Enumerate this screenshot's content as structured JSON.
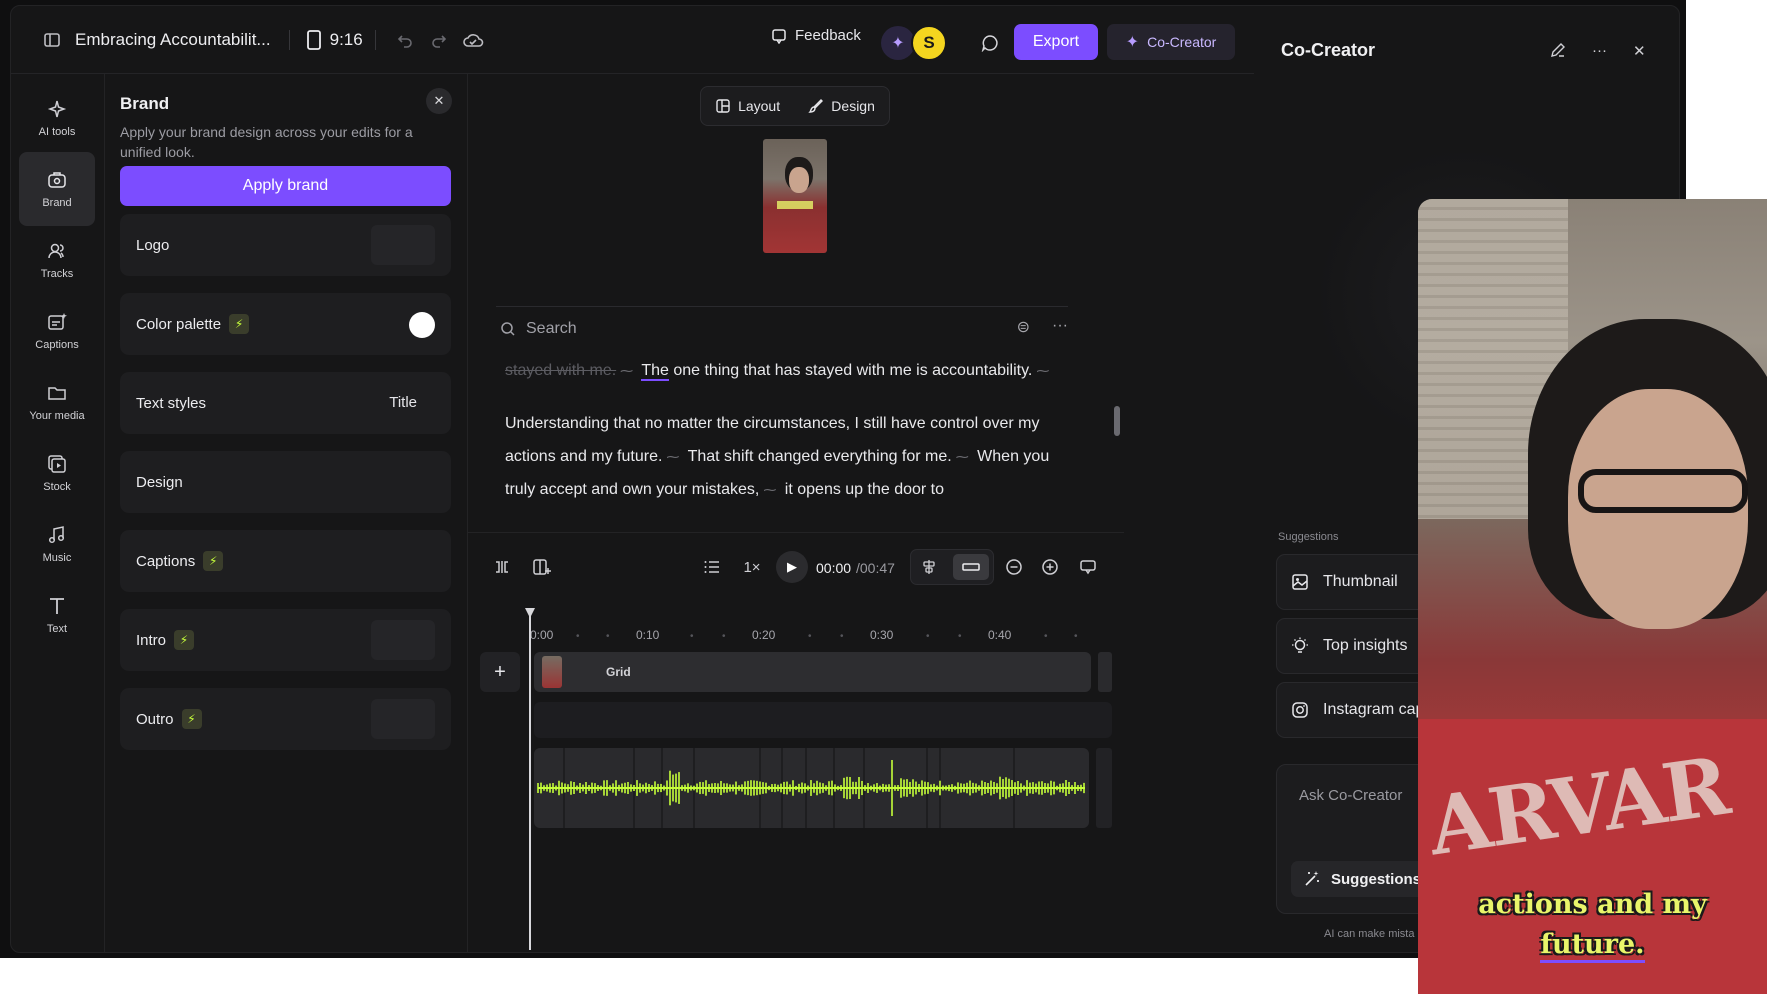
{
  "topbar": {
    "project_title": "Embracing Accountabilit...",
    "aspect_ratio": "9:16",
    "feedback_label": "Feedback",
    "avatar_initial": "S",
    "export_label": "Export",
    "cocreator_label": "Co-Creator",
    "icons": [
      "sidebar-toggle-icon",
      "phone-frame-icon",
      "undo-icon",
      "redo-icon",
      "cloud-save-icon",
      "feedback-icon",
      "sparkle-icon",
      "chat-icon"
    ]
  },
  "rail": {
    "items": [
      {
        "label": "AI tools",
        "icon": "sparkles-icon"
      },
      {
        "label": "Brand",
        "icon": "brand-kit-icon",
        "active": true
      },
      {
        "label": "Tracks",
        "icon": "users-icon"
      },
      {
        "label": "Captions",
        "icon": "captions-icon"
      },
      {
        "label": "Your media",
        "icon": "folder-icon"
      },
      {
        "label": "Stock",
        "icon": "stock-media-icon"
      },
      {
        "label": "Music",
        "icon": "music-note-icon"
      },
      {
        "label": "Text",
        "icon": "text-icon"
      }
    ]
  },
  "brand": {
    "title": "Brand",
    "description": "Apply your brand design across your edits for a unified look.",
    "apply_label": "Apply brand",
    "cards": [
      {
        "label": "Logo",
        "bolt": false,
        "trailing": "box"
      },
      {
        "label": "Color palette",
        "bolt": true,
        "trailing": "white-dot"
      },
      {
        "label": "Text styles",
        "bolt": false,
        "trailing": "text",
        "value": "Title"
      },
      {
        "label": "Design",
        "bolt": false,
        "trailing": "none"
      },
      {
        "label": "Captions",
        "bolt": true,
        "trailing": "none"
      },
      {
        "label": "Intro",
        "bolt": true,
        "trailing": "box"
      },
      {
        "label": "Outro",
        "bolt": true,
        "trailing": "box"
      }
    ]
  },
  "center": {
    "layout_label": "Layout",
    "design_label": "Design",
    "search_placeholder": "Search",
    "transcript": {
      "struck": "stayed with me.",
      "p1_a": "The",
      "p1_b": "one thing that has stayed with me is accountability.",
      "p2_a": "Understanding that no matter the circumstances, I still have control over my actions and my future.",
      "p2_b": "That shift changed everything for me.",
      "p2_c": "When you truly accept and own your mistakes,",
      "p2_d": "it opens up the door to"
    },
    "player": {
      "speed": "1×",
      "current_time": "00:00",
      "total_time": "/00:47"
    },
    "timeline": {
      "ruler": [
        "0:00",
        "0:10",
        "0:20",
        "0:30",
        "0:40"
      ],
      "track_label": "Grid"
    }
  },
  "right_panel": {
    "title": "Co-Creator",
    "suggestions_label": "Suggestions",
    "suggestions": [
      {
        "label": "Thumbnail",
        "icon": "image-icon"
      },
      {
        "label": "Top insights",
        "icon": "lightbulb-icon"
      },
      {
        "label": "Instagram cap",
        "icon": "instagram-icon"
      }
    ],
    "ask_placeholder": "Ask Co-Creator",
    "ask_suggestions_label": "Suggestions",
    "disclaimer": "AI can make mista"
  },
  "overlay": {
    "caption_line1": "actions and my",
    "caption_line2": "future.",
    "shirt_text": "ARVAR"
  },
  "colors": {
    "accent": "#7c4dff",
    "waveform": "#c6ff3a",
    "avatar": "#f4d51f",
    "background": "#161617"
  }
}
